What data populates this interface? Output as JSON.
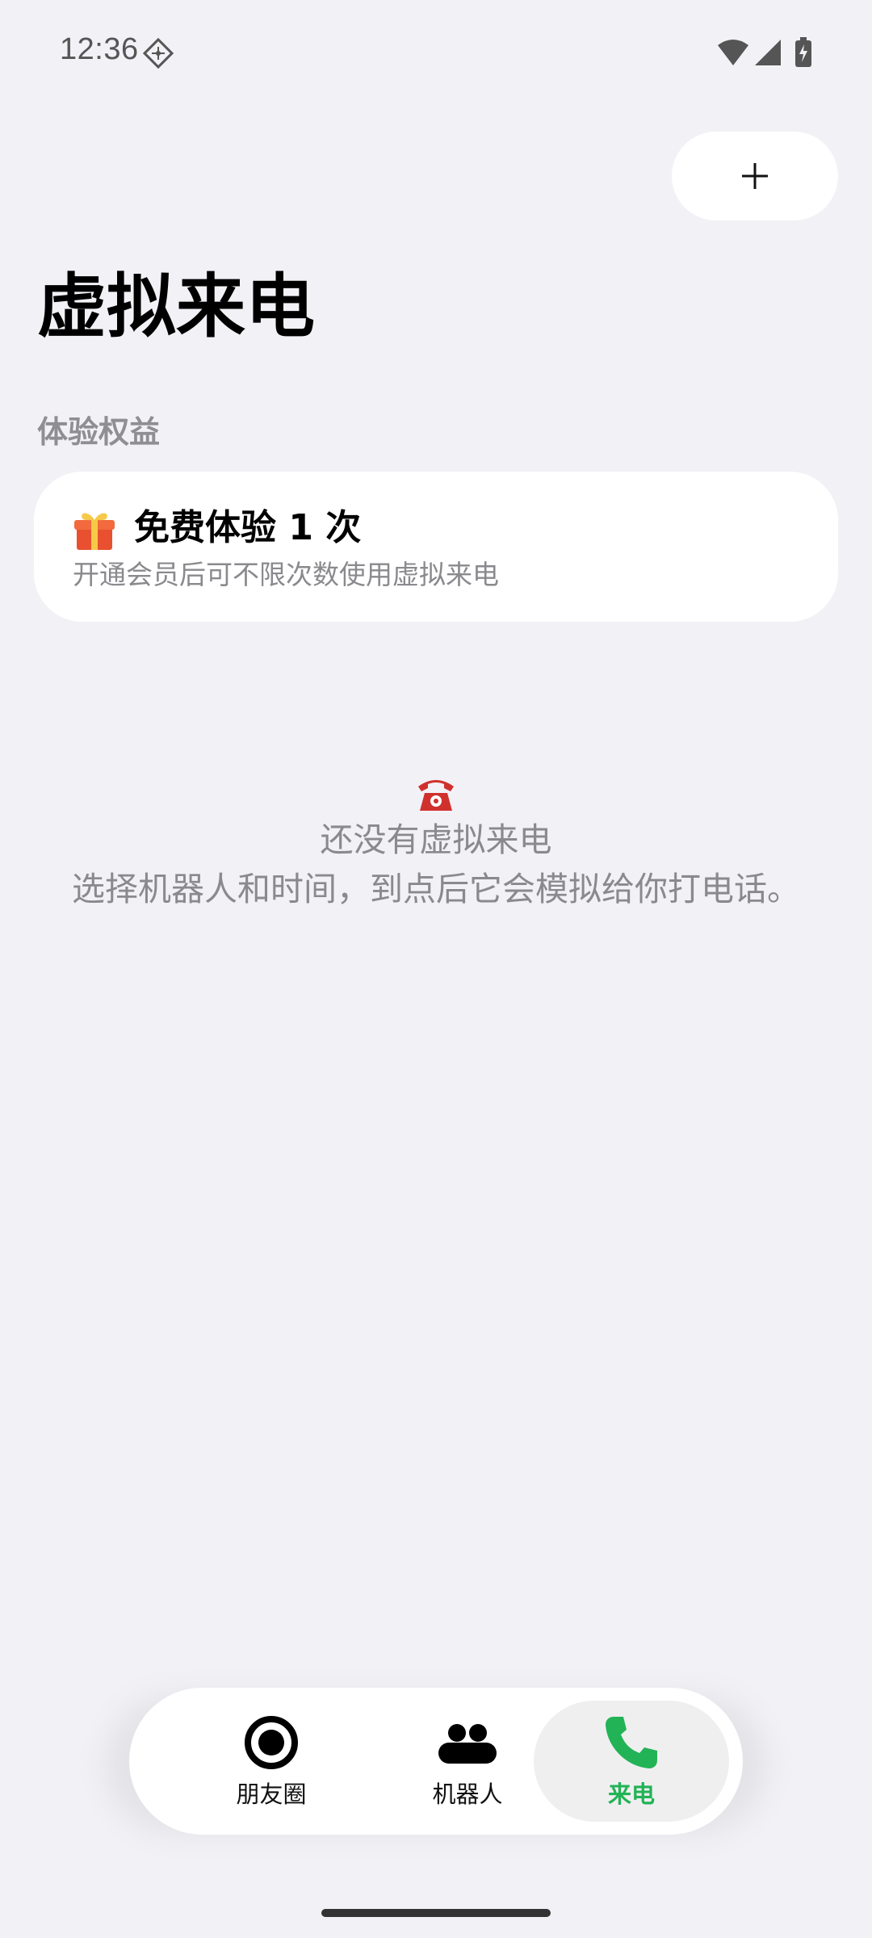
{
  "status_bar": {
    "time": "12:36",
    "icons": [
      "dnd-icon",
      "wifi-icon",
      "signal-icon",
      "battery-charging-icon"
    ]
  },
  "header": {
    "add_icon": "plus-icon",
    "title": "虚拟来电"
  },
  "benefits": {
    "section_label": "体验权益",
    "card": {
      "icon": "gift-icon",
      "title": "免费体验 1 次",
      "description": "开通会员后可不限次数使用虚拟来电"
    }
  },
  "empty_state": {
    "icon": "telephone-icon",
    "title": "还没有虚拟来电",
    "description": "选择机器人和时间，到点后它会模拟给你打电话。"
  },
  "bottom_nav": {
    "items": [
      {
        "label": "朋友圈",
        "icon": "moments-icon",
        "active": false
      },
      {
        "label": "机器人",
        "icon": "robots-icon",
        "active": false
      },
      {
        "label": "来电",
        "icon": "phone-icon",
        "active": true
      }
    ],
    "active_color": "#22b356"
  }
}
